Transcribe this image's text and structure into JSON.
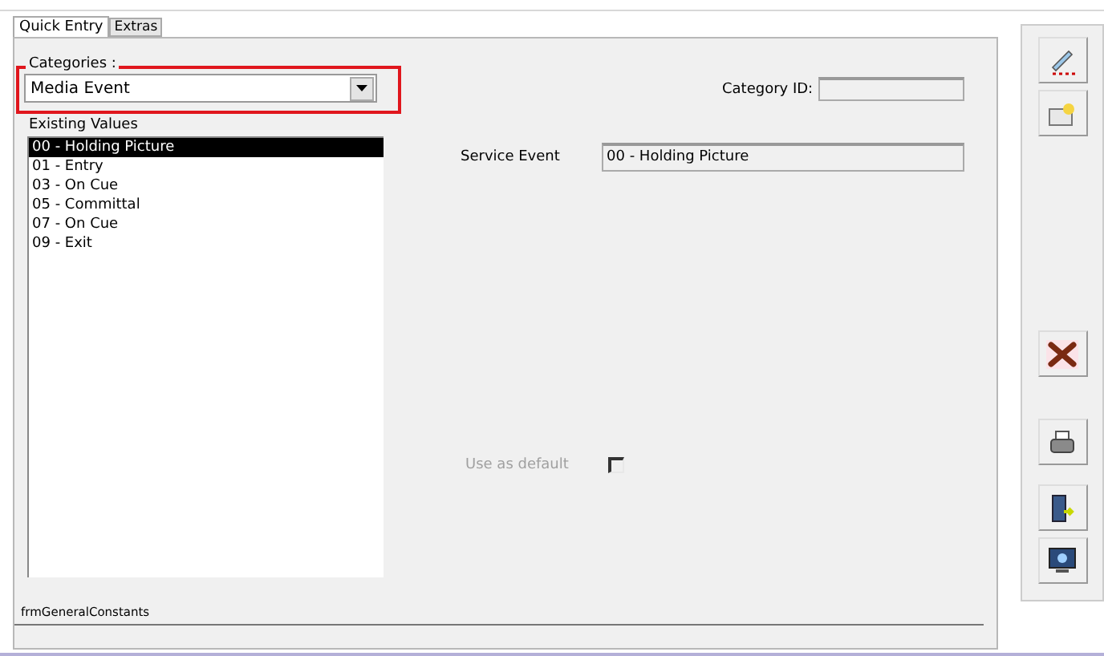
{
  "tabs": [
    {
      "label": "Quick Entry",
      "selected": true
    },
    {
      "label": "Extras",
      "selected": false
    }
  ],
  "categories": {
    "label": "Categories :",
    "value": "Media Event",
    "highlighted": true
  },
  "existing_values": {
    "label": "Existing Values",
    "items": [
      {
        "text": "00 - Holding Picture",
        "selected": true
      },
      {
        "text": "01 - Entry",
        "selected": false
      },
      {
        "text": "03 - On Cue",
        "selected": false
      },
      {
        "text": "05 - Committal",
        "selected": false
      },
      {
        "text": "07 - On Cue",
        "selected": false
      },
      {
        "text": "09 - Exit",
        "selected": false
      }
    ]
  },
  "category_id": {
    "label": "Category ID:"
  },
  "service_event": {
    "label": "Service Event",
    "value": "00 - Holding Picture"
  },
  "use_as_default": {
    "label": "Use as default",
    "checked": false,
    "disabled": true
  },
  "status_bar": {
    "form_name": "frmGeneralConstants"
  },
  "toolbar": [
    {
      "kind": "edit"
    },
    {
      "kind": "new"
    },
    {
      "kind": "spacer"
    },
    {
      "kind": "delete"
    },
    {
      "kind": "print"
    },
    {
      "kind": "exit"
    },
    {
      "kind": "screen"
    }
  ]
}
